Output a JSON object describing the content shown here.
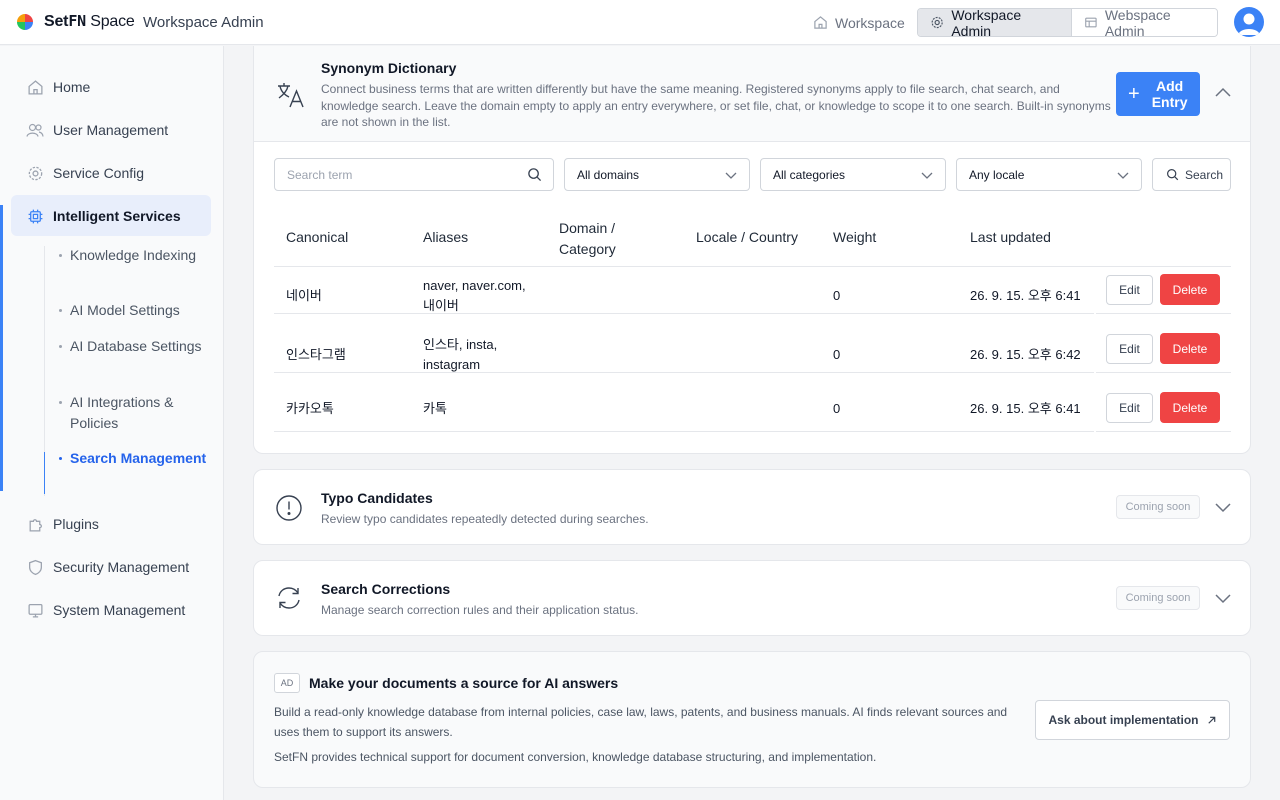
{
  "header": {
    "brand_a": "Set",
    "brand_b": "FN",
    "brand_c": " Space",
    "title": "Workspace Admin",
    "nav": {
      "workspace": "Workspace",
      "workspace_admin": "Workspace Admin",
      "webspace_admin": "Webspace Admin"
    }
  },
  "sidebar": {
    "items": {
      "home": "Home",
      "users": "User Management",
      "service": "Service Config",
      "intelligent": "Intelligent Services",
      "plugins": "Plugins",
      "security": "Security Management",
      "system": "System Management"
    },
    "sub": {
      "knowledge": "Knowledge Indexing",
      "model": "AI Model Settings",
      "database": "AI Database Settings",
      "integrations": "AI Integrations & Policies",
      "search": "Search Management"
    }
  },
  "synonym": {
    "title": "Synonym Dictionary",
    "description": "Connect business terms that are written differently but have the same meaning. Registered synonyms apply to file search, chat search, and knowledge search. Leave the domain empty to apply an entry everywhere, or set file, chat, or knowledge to scope it to one search. Built-in synonyms are not shown in the list.",
    "add_label_1": "Add",
    "add_label_2": "Entry",
    "filters": {
      "search_placeholder": "Search term",
      "domain": "All domains",
      "category": "All categories",
      "locale": "Any locale",
      "search_button": "Search"
    },
    "columns": {
      "canonical": "Canonical",
      "aliases": "Aliases",
      "domain_1": "Domain /",
      "domain_2": "Category",
      "locale": "Locale / Country",
      "weight": "Weight",
      "updated": "Last updated"
    },
    "rows": [
      {
        "canonical": "네이버",
        "aliases_1": "naver, naver.com,",
        "aliases_2": "내이버",
        "weight": "0",
        "updated": "26. 9. 15. 오후 6:41"
      },
      {
        "canonical": "인스타그램",
        "aliases_1": "인스타, insta,",
        "aliases_2": "instagram",
        "weight": "0",
        "updated": "26. 9. 15. 오후 6:42"
      },
      {
        "canonical": "카카오톡",
        "aliases_1": "카톡",
        "aliases_2": "",
        "weight": "0",
        "updated": "26. 9. 15. 오후 6:41"
      }
    ],
    "edit_label": "Edit",
    "delete_label": "Delete"
  },
  "typo": {
    "title": "Typo Candidates",
    "description": "Review typo candidates repeatedly detected during searches.",
    "badge": "Coming soon"
  },
  "corrections": {
    "title": "Search Corrections",
    "description": "Manage search correction rules and their application status.",
    "badge": "Coming soon"
  },
  "ad": {
    "badge": "AD",
    "title": "Make your documents a source for AI answers",
    "line1": "Build a read-only knowledge database from internal policies, case law, laws, patents, and business manuals. AI finds relevant sources and uses them to support its answers.",
    "line2": "SetFN provides technical support for document conversion, knowledge database structuring, and implementation.",
    "cta": "Ask about implementation"
  },
  "colors": {
    "primary": "#3b82f6",
    "danger": "#ef4444",
    "active_text": "#2563eb"
  }
}
